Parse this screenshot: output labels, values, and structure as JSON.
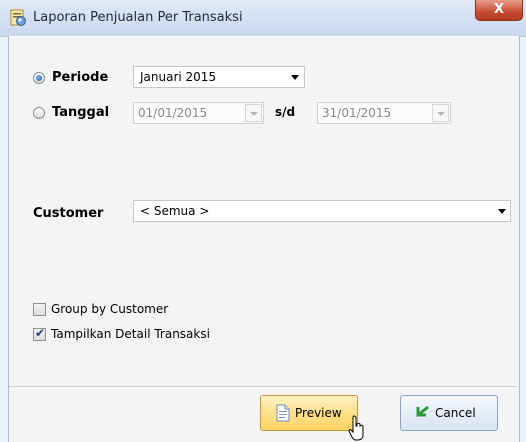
{
  "window": {
    "title": "Laporan Penjualan Per Transaksi",
    "close_label": "X",
    "icon": "report-app-icon"
  },
  "periode": {
    "label": "Periode",
    "selected": true,
    "value": "Januari 2015"
  },
  "tanggal": {
    "label": "Tanggal",
    "selected": false,
    "from": "01/01/2015",
    "separator": "s/d",
    "to": "31/01/2015"
  },
  "customer": {
    "label": "Customer",
    "value": "< Semua >"
  },
  "options": {
    "group_by_customer": {
      "label": "Group by Customer",
      "checked": false
    },
    "show_detail": {
      "label": "Tampilkan Detail Transaksi",
      "checked": true
    }
  },
  "buttons": {
    "preview_label": "Preview",
    "cancel_label": "Cancel"
  },
  "colors": {
    "preview_bg": "#ffe08a",
    "cancel_bg": "#d9e5f3",
    "close_bg": "#c54a32"
  }
}
